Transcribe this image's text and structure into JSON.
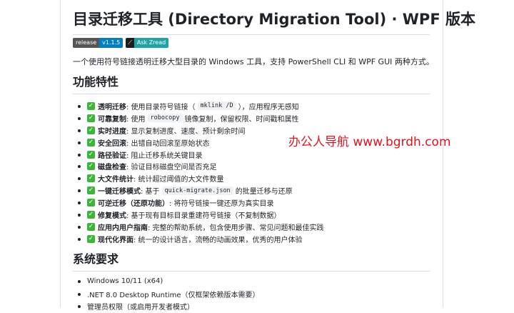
{
  "title": "目录迁移工具 (Directory Migration Tool) · WPF 版本",
  "badges": [
    {
      "left": "release",
      "right": "v1.1.5"
    },
    {
      "left": "⟋",
      "right": "Ask Zread"
    }
  ],
  "intro": "一个使用符号链接透明迁移大型目录的 Windows 工具，支持 PowerShell CLI 和 WPF GUI 两种方式。",
  "features_heading": "功能特性",
  "features": [
    {
      "name": "透明迁移",
      "pre": ": 使用目录符号链接（",
      "code": "mklink /D",
      "post": "），应用程序无感知"
    },
    {
      "name": "可靠复制",
      "pre": ": 使用 ",
      "code": "robocopy",
      "post": " 镜像复制，保留权限、时间戳和属性"
    },
    {
      "name": "实时进度",
      "pre": ": 显示复制进度、速度、预计剩余时间",
      "code": "",
      "post": ""
    },
    {
      "name": "安全回滚",
      "pre": ": 出错自动回滚至原始状态",
      "code": "",
      "post": ""
    },
    {
      "name": "路径验证",
      "pre": ": 阻止迁移系统关键目录",
      "code": "",
      "post": ""
    },
    {
      "name": "磁盘检查",
      "pre": ": 验证目标磁盘空间是否充足",
      "code": "",
      "post": ""
    },
    {
      "name": "大文件统计",
      "pre": ": 统计超过阈值的大文件数量",
      "code": "",
      "post": ""
    },
    {
      "name": "一键迁移模式",
      "pre": ": 基于 ",
      "code": "quick-migrate.json",
      "post": " 的批量迁移与还原"
    },
    {
      "name": "可逆迁移（还原功能）",
      "pre": ": 将符号链接一键还原为真实目录",
      "code": "",
      "post": ""
    },
    {
      "name": "修复模式",
      "pre": ": 基于现有目标目录重建符号链接（不复制数据）",
      "code": "",
      "post": ""
    },
    {
      "name": "应用内用户指南",
      "pre": ": 完整的帮助系统，包含使用步骤、常见问题和最佳实践",
      "code": "",
      "post": ""
    },
    {
      "name": "现代化界面",
      "pre": ": 统一的设计语言，流畅的动画效果，优秀的用户体验",
      "code": "",
      "post": ""
    }
  ],
  "requirements_heading": "系统要求",
  "requirements": [
    "Windows 10/11 (x64)",
    ".NET 8.0 Desktop Runtime（仅框架依赖版本需要）",
    "管理员权限（或启用开发者模式）"
  ],
  "watermark": "办公人导航 www.bgrdh.com",
  "colors": {
    "check": "#3fb43a",
    "release_badge": "#007ec6",
    "zread_badge": "#1fa3a3",
    "watermark": "#e0141e"
  }
}
